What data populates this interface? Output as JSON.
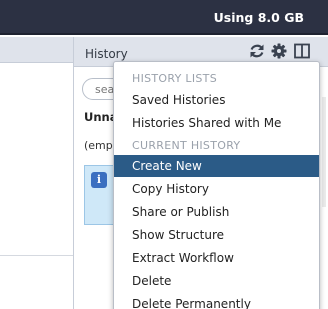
{
  "topbar": {
    "usage_text": "Using 8.0 GB"
  },
  "history_panel": {
    "title": "History",
    "icons": [
      "refresh-icon",
      "gear-icon",
      "columns-icon"
    ],
    "search_placeholder": "sea",
    "history_name": "Unna",
    "empty_text": "(emp"
  },
  "dropdown": {
    "section_history_lists": "HISTORY LISTS",
    "section_current_history": "CURRENT HISTORY",
    "items": [
      {
        "label": "Saved Histories"
      },
      {
        "label": "Histories Shared with Me"
      },
      {
        "label": "Create New"
      },
      {
        "label": "Copy History"
      },
      {
        "label": "Share or Publish"
      },
      {
        "label": "Show Structure"
      },
      {
        "label": "Extract Workflow"
      },
      {
        "label": "Delete"
      },
      {
        "label": "Delete Permanently"
      }
    ]
  },
  "colors": {
    "topbar": "#2c3143",
    "panel_header": "#dfe3eb",
    "active_item": "#2b5b87",
    "info_box": "#cfe8f8",
    "info_icon": "#3b6fc0"
  }
}
